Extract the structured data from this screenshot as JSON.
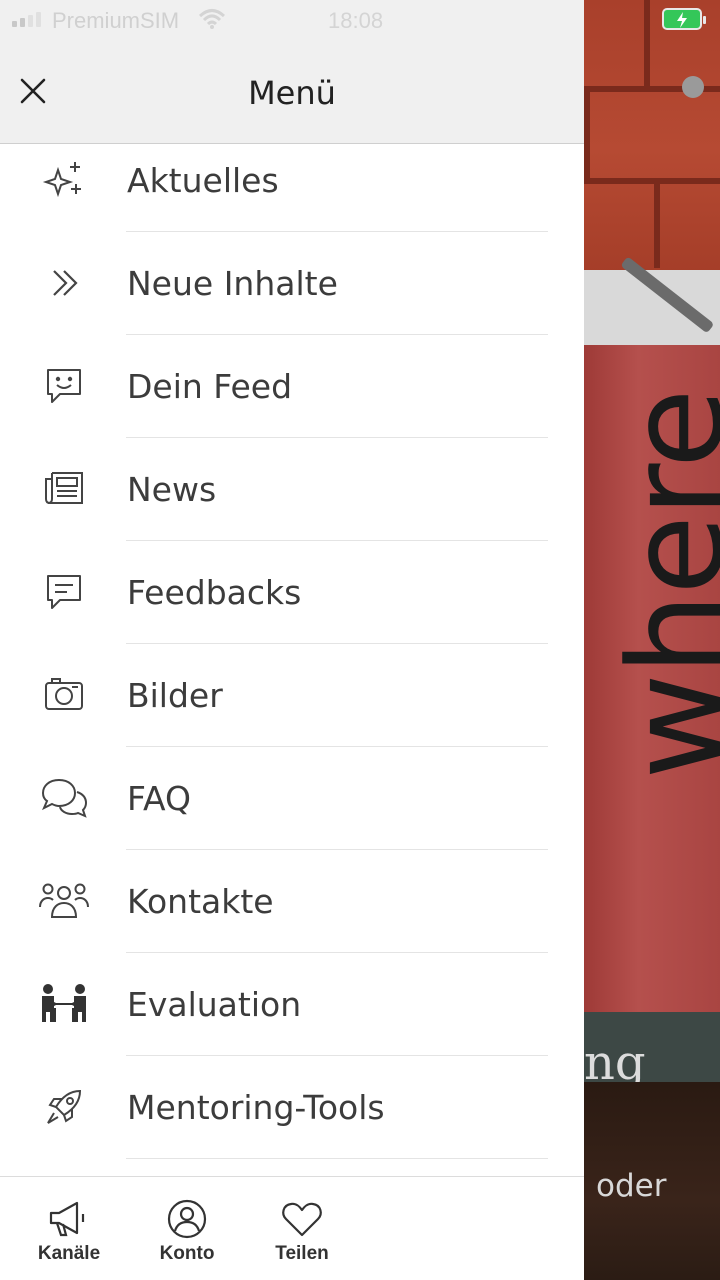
{
  "status_bar": {
    "carrier": "PremiumSIM",
    "time": "18:08"
  },
  "header": {
    "title": "Menü"
  },
  "menu": {
    "items": [
      {
        "label": "Aktuelles",
        "icon": "sparkles-icon"
      },
      {
        "label": "Neue Inhalte",
        "icon": "double-chevron-right-icon"
      },
      {
        "label": "Dein Feed",
        "icon": "smile-chat-icon"
      },
      {
        "label": "News",
        "icon": "newspaper-icon"
      },
      {
        "label": "Feedbacks",
        "icon": "message-lines-icon"
      },
      {
        "label": "Bilder",
        "icon": "camera-icon"
      },
      {
        "label": "FAQ",
        "icon": "chat-bubbles-icon"
      },
      {
        "label": "Kontakte",
        "icon": "group-icon"
      },
      {
        "label": "Evaluation",
        "icon": "people-exchange-icon"
      },
      {
        "label": "Mentoring-Tools",
        "icon": "rocket-icon"
      }
    ]
  },
  "bottom_nav": {
    "items": [
      {
        "label": "Kanäle",
        "icon": "megaphone-icon"
      },
      {
        "label": "Konto",
        "icon": "user-circle-icon"
      },
      {
        "label": "Teilen",
        "icon": "heart-icon"
      }
    ]
  },
  "background": {
    "vertical_text": "where",
    "fragment_1": "ng",
    "fragment_2": "oder"
  }
}
